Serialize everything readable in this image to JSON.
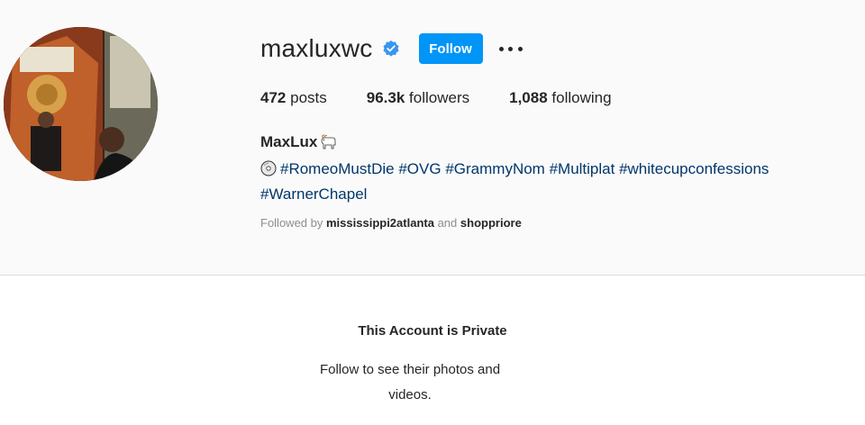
{
  "profile": {
    "username": "maxluxwc",
    "follow_label": "Follow",
    "more_icon": "more-horizontal-icon",
    "verified_icon": "verified-badge-icon",
    "verified_color": "#3897f0",
    "stats": {
      "posts_count": "472",
      "posts_label": "posts",
      "followers_count": "96.3k",
      "followers_label": "followers",
      "following_count": "1,088",
      "following_label": "following"
    },
    "full_name": "MaxLux",
    "full_name_emoji": "goat-emoji-icon",
    "bio_disc_icon": "optical-disc-icon",
    "bio_tags": [
      "#RomeoMustDie",
      "#OVG",
      "#GrammyNom",
      "#Multiplat",
      "#whitecupconfessions",
      "#WarnerChapel"
    ],
    "followed_by": {
      "prefix": "Followed by",
      "user1": "mississippi2atlanta",
      "joiner": "and",
      "user2": "shoppriore"
    }
  },
  "private_notice": {
    "title": "This Account is Private",
    "subtitle": "Follow to see their photos and videos."
  },
  "colors": {
    "accent": "#0095f6",
    "link": "#00376b",
    "muted": "#8e8e8e",
    "text": "#262626"
  }
}
